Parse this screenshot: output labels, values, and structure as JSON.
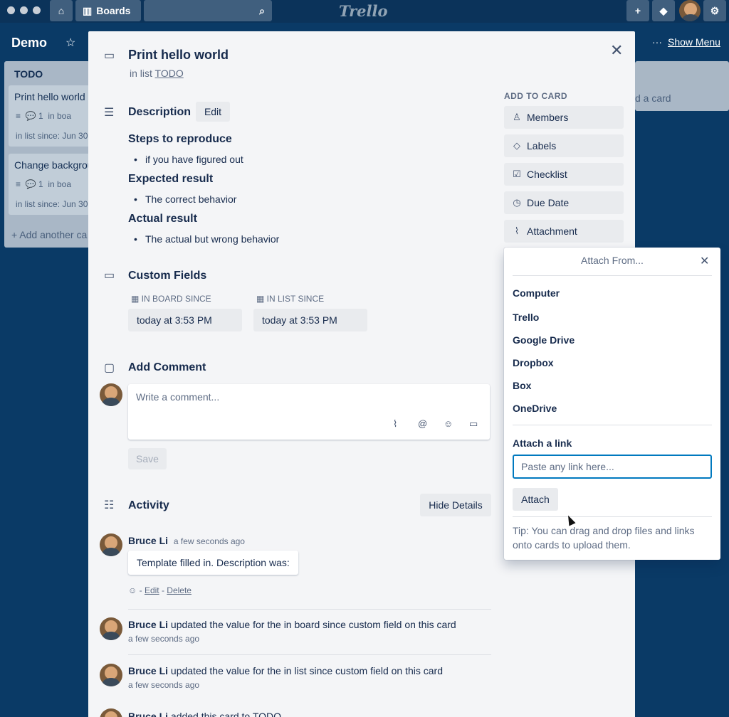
{
  "topbar": {
    "boards_label": "Boards",
    "logo": "Trello"
  },
  "board": {
    "title": "Demo",
    "show_menu": "Show Menu",
    "more": "···"
  },
  "lists": {
    "todo_title": "TODO",
    "cards": [
      {
        "title": "Print hello world",
        "comments": "1",
        "meta": "in boa",
        "since": "in list since: Jun 30"
      },
      {
        "title": "Change backgrou",
        "comments": "1",
        "meta": "in boa",
        "since": "in list since: Jun 30"
      }
    ],
    "add_card": "+ Add another ca",
    "right_add_card": "d a card"
  },
  "card": {
    "title": "Print hello world",
    "in_list_prefix": "in list",
    "list_name": "TODO"
  },
  "description": {
    "heading": "Description",
    "edit_label": "Edit",
    "blocks": [
      {
        "heading": "Steps to reproduce",
        "item": "if you have figured out"
      },
      {
        "heading": "Expected result",
        "item": "The correct behavior"
      },
      {
        "heading": "Actual result",
        "item": "The actual but wrong behavior"
      }
    ]
  },
  "custom_fields": {
    "heading": "Custom Fields",
    "fields": [
      {
        "label": "IN BOARD SINCE",
        "value": "today at 3:53 PM"
      },
      {
        "label": "IN LIST SINCE",
        "value": "today at 3:53 PM"
      }
    ]
  },
  "add_comment": {
    "heading": "Add Comment",
    "placeholder": "Write a comment...",
    "save_label": "Save"
  },
  "activity": {
    "heading": "Activity",
    "hide_details": "Hide Details",
    "entries": [
      {
        "name": "Bruce Li",
        "time": "a few seconds ago",
        "comment": "Template filled in. Description was:",
        "edit": "Edit",
        "delete": "Delete"
      },
      {
        "name": "Bruce Li",
        "text": "updated the value for the in board since custom field on this card",
        "time": "a few seconds ago"
      },
      {
        "name": "Bruce Li",
        "text": "updated the value for the in list since custom field on this card",
        "time": "a few seconds ago"
      },
      {
        "name": "Bruce Li",
        "text": "added this card to TODO"
      }
    ]
  },
  "sidebar": {
    "heading": "ADD TO CARD",
    "buttons": [
      {
        "label": "Members",
        "icon": "person-icon"
      },
      {
        "label": "Labels",
        "icon": "tag-icon"
      },
      {
        "label": "Checklist",
        "icon": "checkbox-icon"
      },
      {
        "label": "Due Date",
        "icon": "clock-icon"
      },
      {
        "label": "Attachment",
        "icon": "paperclip-icon"
      }
    ]
  },
  "attach_popover": {
    "title": "Attach From...",
    "sources": [
      "Computer",
      "Trello",
      "Google Drive",
      "Dropbox",
      "Box",
      "OneDrive"
    ],
    "link_heading": "Attach a link",
    "link_placeholder": "Paste any link here...",
    "attach_label": "Attach",
    "tip": "Tip: You can drag and drop files and links onto cards to upload them."
  },
  "colors": {
    "board_bg": "#0a3a66",
    "modal_bg": "#f4f5f7",
    "accent": "#0079bf"
  }
}
